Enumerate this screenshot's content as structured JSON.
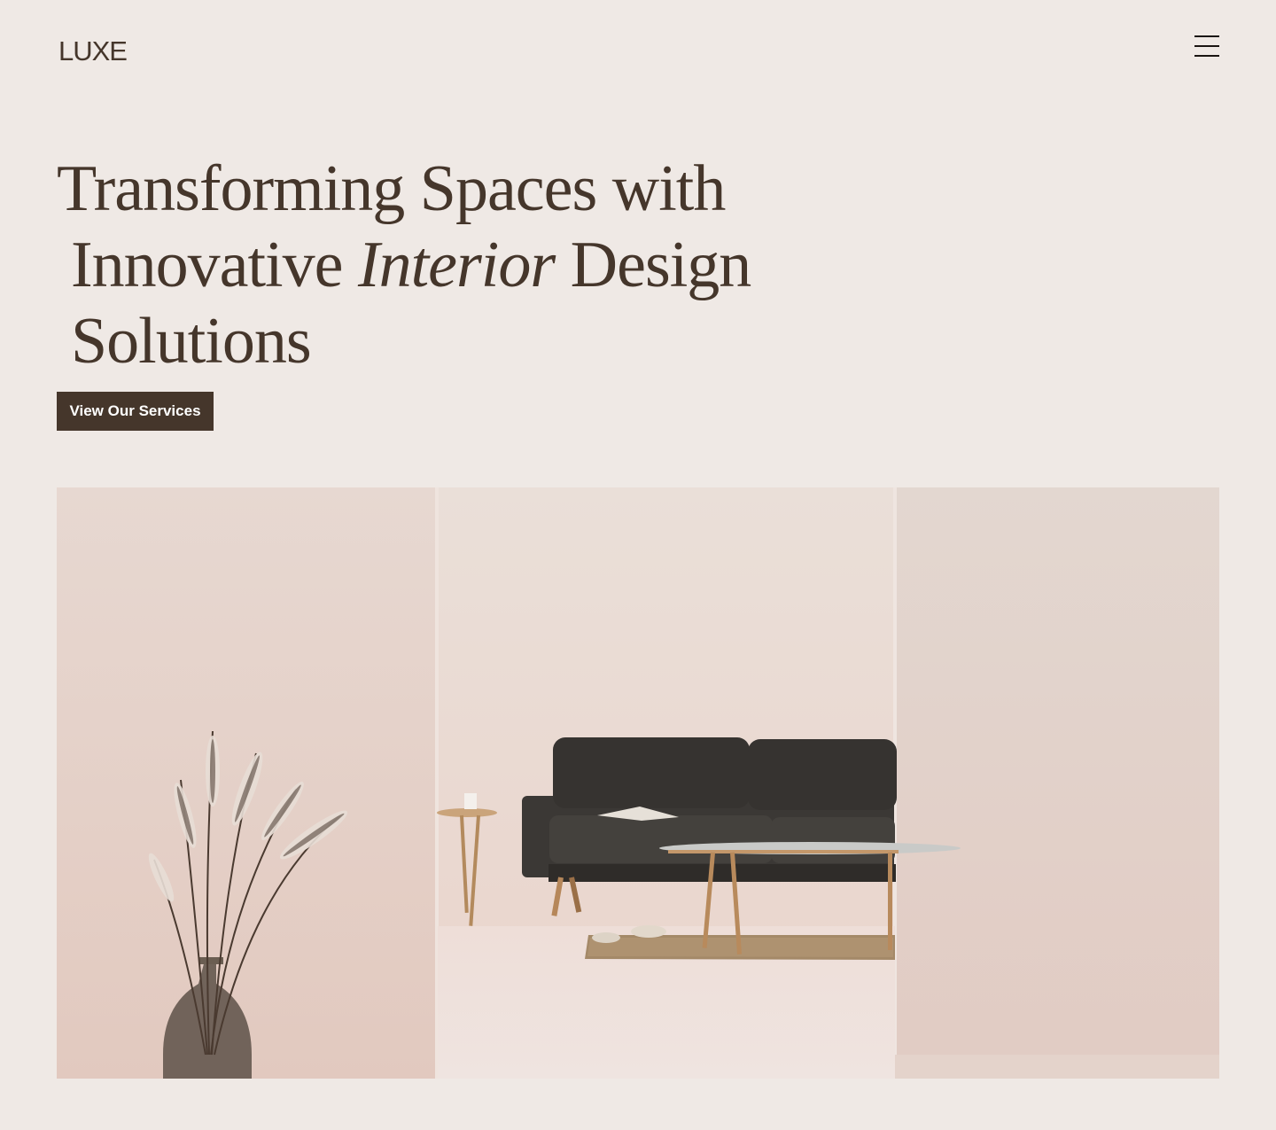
{
  "header": {
    "logo": "LUXE",
    "menu_icon": "hamburger-menu-icon"
  },
  "hero": {
    "title_line_1": "Transforming Spaces with",
    "title_line_2_before": "Innovative ",
    "title_line_2_italic": "Interior",
    "title_line_2_after": " Design",
    "title_line_3": "Solutions",
    "cta_label": "View Our Services"
  },
  "colors": {
    "background": "#efe9e5",
    "text": "#45362b",
    "button": "#45362b"
  }
}
